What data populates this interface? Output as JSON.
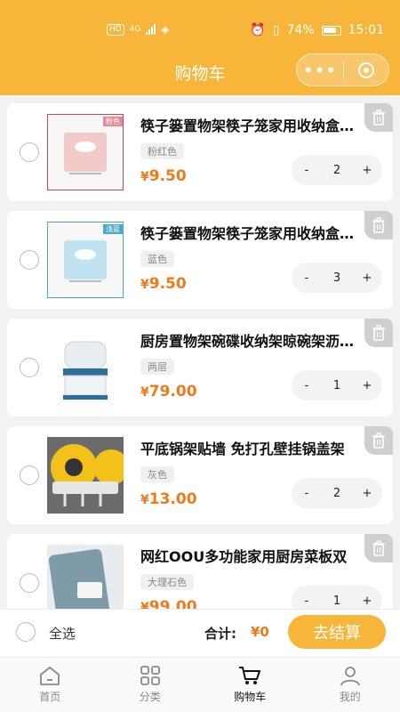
{
  "status_bar": {
    "network": "4G",
    "battery": "74%",
    "time": "15:01"
  },
  "header": {
    "title": "购物车",
    "menu_glyph": "•••"
  },
  "cart_items": [
    {
      "name": "筷子篓置物架筷子笼家用收纳盒…",
      "spec": "粉红色",
      "currency": "¥",
      "price": "9.50",
      "qty": "2",
      "minus": "-",
      "plus": "+",
      "thumb_label": "粉色",
      "thumb_color": "#f2cbc9"
    },
    {
      "name": "筷子篓置物架筷子笼家用收纳盒…",
      "spec": "蓝色",
      "currency": "¥",
      "price": "9.50",
      "qty": "3",
      "minus": "-",
      "plus": "+",
      "thumb_label": "浅蓝",
      "thumb_color": "#bfe3f2"
    },
    {
      "name": "厨房置物架碗碟收纳架晾碗架沥…",
      "spec": "两层",
      "currency": "¥",
      "price": "79.00",
      "qty": "1",
      "minus": "-",
      "plus": "+",
      "thumb_label": "",
      "thumb_color": "#2d6f9a"
    },
    {
      "name": "平底锅架贴墙 免打孔壁挂锅盖架",
      "spec": "灰色",
      "currency": "¥",
      "price": "13.00",
      "qty": "2",
      "minus": "-",
      "plus": "+",
      "thumb_label": "",
      "thumb_color": "#f2c21b"
    },
    {
      "name": "网红OOU多功能家用厨房菜板双",
      "spec": "大理石色",
      "currency": "¥",
      "price": "99.00",
      "qty": "1",
      "minus": "-",
      "plus": "+",
      "thumb_label": "",
      "thumb_color": "#7f9aa8"
    }
  ],
  "footer": {
    "select_all": "全选",
    "total_label": "合计:",
    "total_value": "¥0",
    "checkout": "去结算"
  },
  "tabbar": [
    {
      "label": "首页",
      "icon": "home-icon"
    },
    {
      "label": "分类",
      "icon": "category-icon"
    },
    {
      "label": "购物车",
      "icon": "cart-icon"
    },
    {
      "label": "我的",
      "icon": "user-icon"
    }
  ],
  "colors": {
    "accent": "#f7b53a",
    "price": "#ef7a1a"
  }
}
